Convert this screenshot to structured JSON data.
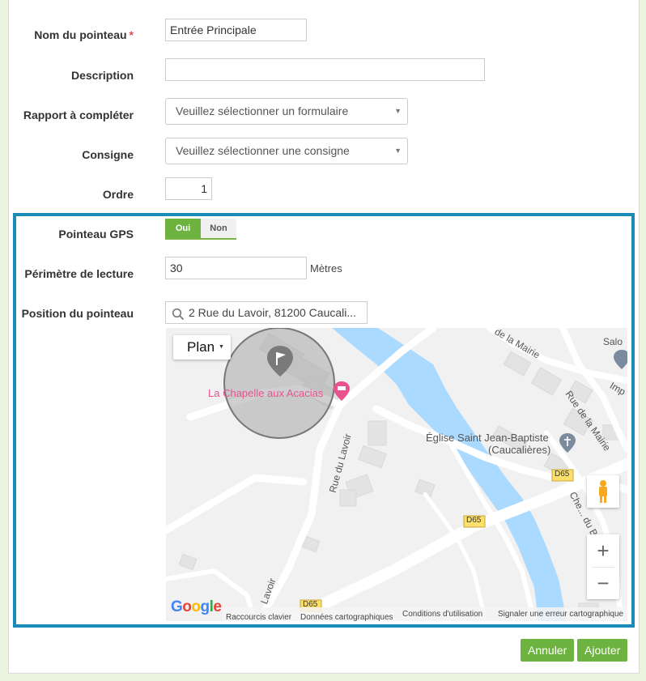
{
  "form": {
    "name_label": "Nom du pointeau",
    "required_mark": "*",
    "name_value": "Entrée Principale",
    "description_label": "Description",
    "description_value": "",
    "report_label": "Rapport à compléter",
    "report_value": "Veuillez sélectionner un formulaire",
    "instruction_label": "Consigne",
    "instruction_value": "Veuillez sélectionner une consigne",
    "order_label": "Ordre",
    "order_value": "1"
  },
  "gps": {
    "gps_label": "Pointeau GPS",
    "toggle_on": "Oui",
    "toggle_off": "Non",
    "selected": "Oui",
    "perimeter_label": "Périmètre de lecture",
    "perimeter_value": "30",
    "perimeter_unit": "Mètres",
    "position_label": "Position du pointeau",
    "position_value": "2 Rue du Lavoir, 81200 Caucali..."
  },
  "map": {
    "map_type_button": "Plan",
    "poi_chapelle": "La Chapelle aux Acacias",
    "poi_eglise_line1": "Église Saint Jean-Baptiste",
    "poi_eglise_line2": "(Caucalières)",
    "street_lavoir": "Rue du Lavoir",
    "street_lavoir_short": "Lavoir",
    "street_mairie": "de la Mairie",
    "street_mairie2": "Rue de la Mairie",
    "street_chemin": "Che... du Bo",
    "road_d65": "D65",
    "poi_salon": "Salo",
    "poi_imp": "Imp",
    "zoom_in": "+",
    "zoom_out": "−",
    "logo": "Google",
    "footer_keyboard": "Raccourcis clavier",
    "footer_data": "Données cartographiques",
    "footer_terms": "Conditions d'utilisation",
    "footer_report": "Signaler une erreur cartographique",
    "colors": {
      "water": "#aadaff",
      "land": "#f1f1f1",
      "road": "#ffffff",
      "building": "#e3e3e3",
      "circle": "#a8a8a8"
    }
  },
  "actions": {
    "cancel": "Annuler",
    "add": "Ajouter"
  },
  "theme": {
    "accent": "#6cb33f",
    "highlight_border": "#1a8ab6"
  }
}
